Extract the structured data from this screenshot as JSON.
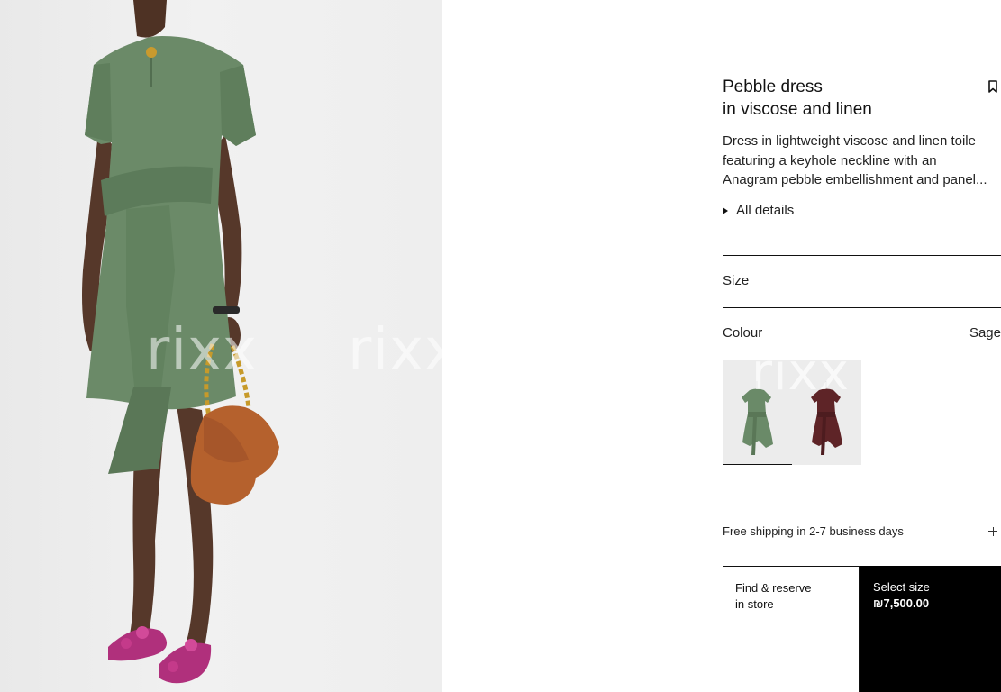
{
  "watermark": "rixx",
  "product": {
    "title_line1": "Pebble dress",
    "title_line2": "in viscose and linen",
    "description_lines": [
      "Dress in lightweight viscose and linen toile",
      "featuring a keyhole neckline with an",
      "Anagram pebble embellishment and panel..."
    ],
    "all_details_label": "All details"
  },
  "size": {
    "label": "Size"
  },
  "colour": {
    "label": "Colour",
    "selected_value": "Sage",
    "swatches": [
      {
        "name": "sage",
        "color": "#6a8a68",
        "selected": true
      },
      {
        "name": "burgundy",
        "color": "#5e2427",
        "selected": false
      }
    ]
  },
  "shipping": {
    "label": "Free shipping in 2-7 business days"
  },
  "actions": {
    "reserve_line1": "Find & reserve",
    "reserve_line2": "in store",
    "select_label": "Select size",
    "price": "₪7,500.00"
  },
  "colors": {
    "dress": "#6b8a68",
    "dress_shadow": "#5a7757",
    "bag": "#b5612d",
    "sandals": "#b0307c",
    "skin": "#5a3a2a",
    "cta_bg": "#000000"
  }
}
